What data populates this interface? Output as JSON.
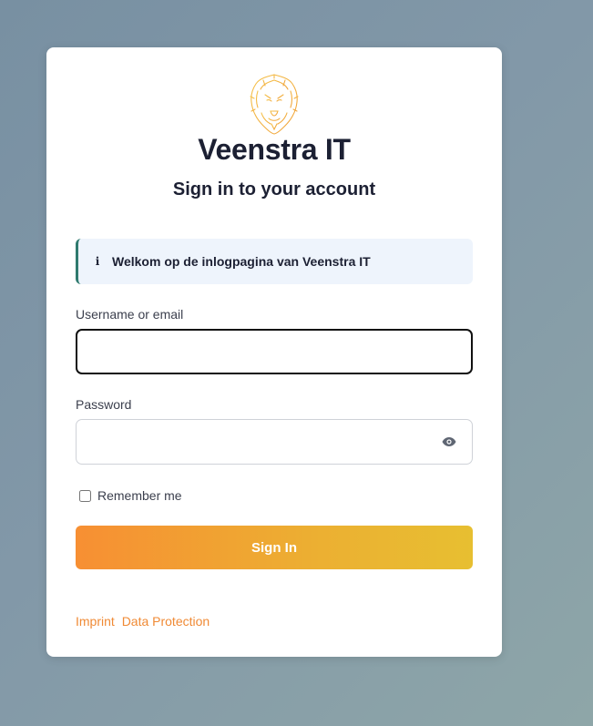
{
  "brand": {
    "name": "Veenstra IT",
    "logo_icon": "lion-head-icon",
    "logo_color": "#f2b93c"
  },
  "subtitle": "Sign in to your account",
  "alert": {
    "icon": "info-icon",
    "icon_glyph": "i",
    "message": "Welkom op de inlogpagina van Veenstra IT"
  },
  "form": {
    "username_label": "Username or email",
    "username_value": "",
    "password_label": "Password",
    "password_value": "",
    "password_toggle_icon": "eye-icon",
    "remember_label": "Remember me",
    "remember_checked": false,
    "submit_label": "Sign In"
  },
  "footer": {
    "links": [
      "Imprint",
      "Data Protection"
    ]
  },
  "colors": {
    "accent_start": "#f78f33",
    "accent_end": "#e7bf31",
    "link": "#f08a35",
    "alert_border": "#2f7a6e",
    "alert_bg": "#eef4fc"
  }
}
